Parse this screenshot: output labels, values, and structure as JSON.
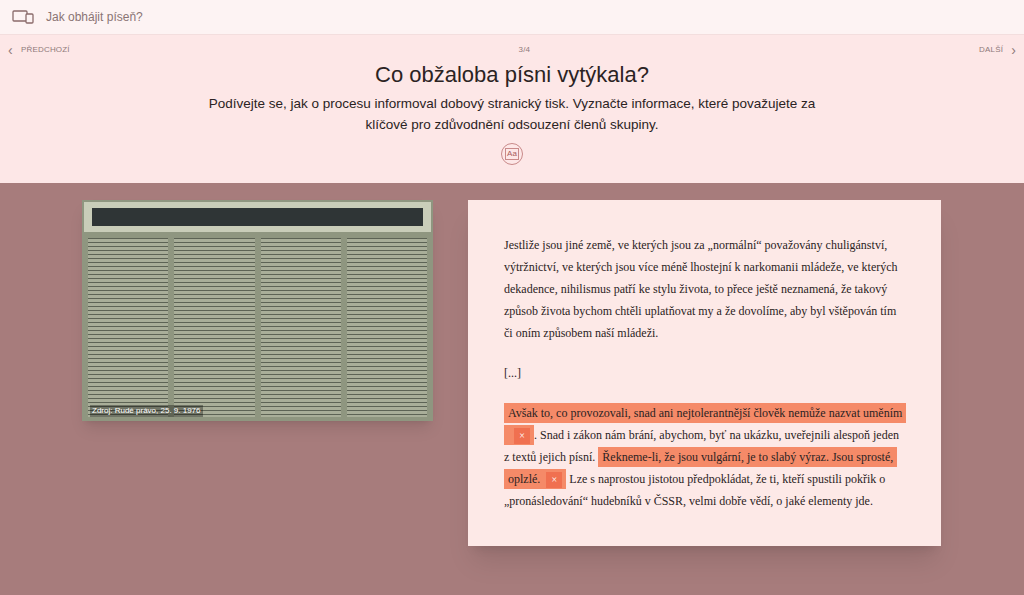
{
  "window": {
    "title": "Jak obhájit píseň?"
  },
  "navigation": {
    "previous": "PŘEDCHOZÍ",
    "page": "3/4",
    "next": "DALŠÍ",
    "previous_arrow": "‹",
    "next_arrow": "›"
  },
  "header": {
    "title": "Co obžaloba písni vytýkala?",
    "subtitle_lines": [
      "Podívejte se, jak o procesu informoval dobový stranický tisk. Vyznačte informace, které považujete za",
      "klíčové pro zdůvodnění odsouzení členů skupiny."
    ],
    "text_size_button": "Aa"
  },
  "image": {
    "caption": "Zdroj: Rudé právo, 25. 9. 1976"
  },
  "article": {
    "paragraphs": [
      {
        "segments": [
          {
            "text": "Jestliže jsou jiné země, ve kterých jsou za „normální“ považovány chuligánství, výtržnictví, ve kterých jsou více méně lhostejní k narkomanii mládeže, ve kterých dekadence, nihilismus patří ke stylu života, to přece ještě neznamená, že takový způsob života bychom chtěli uplatňovat my a že dovolíme, aby byl vštěpován tím či oním způsobem naší mládeži.",
            "highlighted": false
          }
        ]
      },
      {
        "segments": [
          {
            "text": "[...]",
            "highlighted": false
          }
        ]
      },
      {
        "segments": [
          {
            "text": "Avšak to, co provozovali, snad ani nejtolerantnější člověk nemůže nazvat uměním",
            "highlighted": true,
            "remove": "×"
          },
          {
            "text": ". Snad i zákon nám brání, abychom, byť na ukázku, uveřejnili alespoň jeden z textů jejich písní. ",
            "highlighted": false
          },
          {
            "text": "Řekneme-li, že jsou vulgární, je to slabý výraz. Jsou sprosté, oplzlé.",
            "highlighted": true,
            "remove": "×"
          },
          {
            "text": " Lze s naprostou jistotou předpokládat, že ti, kteří spustili pokřik o „pronásledování“ hudebníků v ČSSR, velmi dobře vědí, o jaké elementy jde.",
            "highlighted": false
          }
        ]
      }
    ]
  }
}
